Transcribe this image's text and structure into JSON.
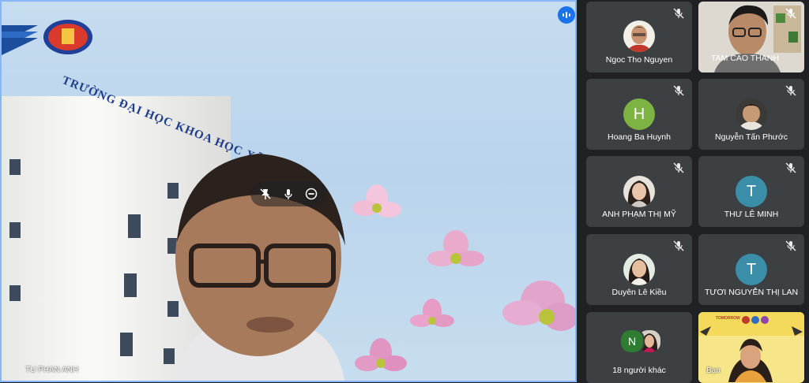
{
  "main": {
    "name": "TU PHAN ANH",
    "sign_text": "TRƯỜNG ĐẠI HỌC KHOA HỌC XÃ HỘI"
  },
  "tiles": [
    {
      "name": "Ngoc Tho Nguyen",
      "type": "photo"
    },
    {
      "name": "TAM CAO THANH",
      "type": "video"
    },
    {
      "name": "Hoang Ba Huynh",
      "type": "letter",
      "letter": "H",
      "color": "#7cb342"
    },
    {
      "name": "Nguyễn Tấn Phước",
      "type": "photo"
    },
    {
      "name": "ANH PHẠM THỊ MỸ",
      "type": "photo"
    },
    {
      "name": "THƯ LÊ MINH",
      "type": "letter",
      "letter": "T",
      "color": "#3a8ea8"
    },
    {
      "name": "Duyên Lê Kiều",
      "type": "photo"
    },
    {
      "name": "TƯƠI NGUYỄN THỊ LAN",
      "type": "letter",
      "letter": "T",
      "color": "#3a8ea8"
    },
    {
      "name": "18 người khác",
      "type": "group",
      "letter": "N",
      "color": "#2e7d32"
    },
    {
      "name": "Bạn",
      "type": "self",
      "banner": "TOMORROW"
    }
  ],
  "colors": {
    "accent": "#1a73e8",
    "tile_bg": "#3c4043",
    "page_bg": "#202124"
  }
}
